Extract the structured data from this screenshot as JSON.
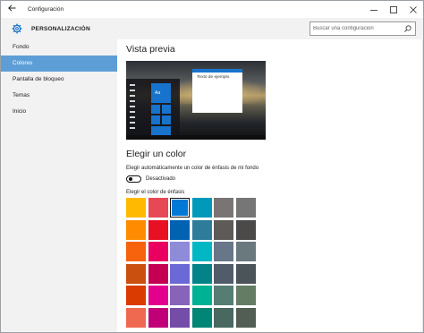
{
  "window": {
    "title": "Configuración",
    "back_icon": "arrow-left-icon",
    "minimize_glyph": "—",
    "maximize_glyph": "☐",
    "close_glyph": "✕"
  },
  "header": {
    "title": "PERSONALIZACIÓN",
    "icon": "gear-icon",
    "search_placeholder": "Buscar una configuración"
  },
  "sidebar": {
    "items": [
      {
        "label": "Fondo",
        "active": false
      },
      {
        "label": "Colores",
        "active": true
      },
      {
        "label": "Pantalla de bloqueo",
        "active": false
      },
      {
        "label": "Temas",
        "active": false
      },
      {
        "label": "Inicio",
        "active": false
      }
    ]
  },
  "main": {
    "preview_title": "Vista previa",
    "preview_tile_label": "Aa",
    "preview_window_text": "Texto de ejemplo",
    "color_section_title": "Elegir un color",
    "auto_accent_label": "Elegir automáticamente un color de énfasis de mi fondo",
    "toggle_state_label": "Desactivado",
    "toggle_on": false,
    "accent_label": "Elegir el color de énfasis"
  },
  "accent_colors": {
    "accent": "#1773cc",
    "rows": [
      [
        "#ffb900",
        "#e74856",
        "#0078d7",
        "#0099bc",
        "#7a7574",
        "#767676"
      ],
      [
        "#ff8c00",
        "#e81123",
        "#0063b1",
        "#2d7d9a",
        "#5d5a58",
        "#4c4a48"
      ],
      [
        "#f7630c",
        "#ea005e",
        "#8e8cd8",
        "#00b7c3",
        "#68768a",
        "#69797e"
      ],
      [
        "#ca5010",
        "#c30052",
        "#6b69d6",
        "#038387",
        "#515c6b",
        "#4a5459"
      ],
      [
        "#da3b01",
        "#e3008c",
        "#8764b8",
        "#00b294",
        "#567c73",
        "#647c64"
      ],
      [
        "#ef6950",
        "#bf0077",
        "#744da9",
        "#018574",
        "#486860",
        "#525e54"
      ]
    ],
    "selected": [
      0,
      2
    ]
  }
}
